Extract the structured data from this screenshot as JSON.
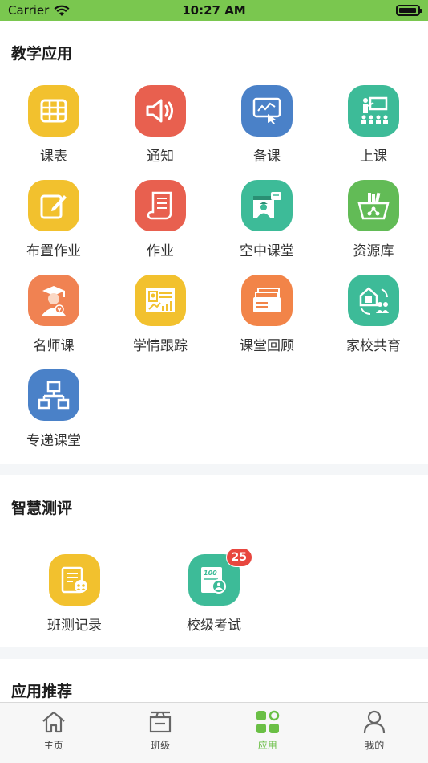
{
  "status": {
    "carrier": "Carrier",
    "time": "10:27 AM"
  },
  "teaching": {
    "title": "教学应用",
    "apps": [
      {
        "label": "课表",
        "color": "#f2c12e"
      },
      {
        "label": "通知",
        "color": "#e8604f"
      },
      {
        "label": "备课",
        "color": "#4a81c8"
      },
      {
        "label": "上课",
        "color": "#3dbb98"
      },
      {
        "label": "布置作业",
        "color": "#f2c12e"
      },
      {
        "label": "作业",
        "color": "#e8604f"
      },
      {
        "label": "空中课堂",
        "color": "#3dbb98"
      },
      {
        "label": "资源库",
        "color": "#62bb56"
      },
      {
        "label": "名师课",
        "color": "#f08252"
      },
      {
        "label": "学情跟踪",
        "color": "#f2c12e"
      },
      {
        "label": "课堂回顾",
        "color": "#f28448"
      },
      {
        "label": "家校共育",
        "color": "#3dbb98"
      },
      {
        "label": "专递课堂",
        "color": "#4a81c8"
      }
    ]
  },
  "assessment": {
    "title": "智慧测评",
    "apps": [
      {
        "label": "班测记录",
        "color": "#f2c12e"
      },
      {
        "label": "校级考试",
        "color": "#3dbb98",
        "badge": "25"
      }
    ]
  },
  "recommend": {
    "title": "应用推荐"
  },
  "tabbar": {
    "tabs": [
      {
        "label": "主页"
      },
      {
        "label": "班级"
      },
      {
        "label": "应用",
        "active": true
      },
      {
        "label": "我的"
      }
    ],
    "active_color": "#6abf45"
  }
}
